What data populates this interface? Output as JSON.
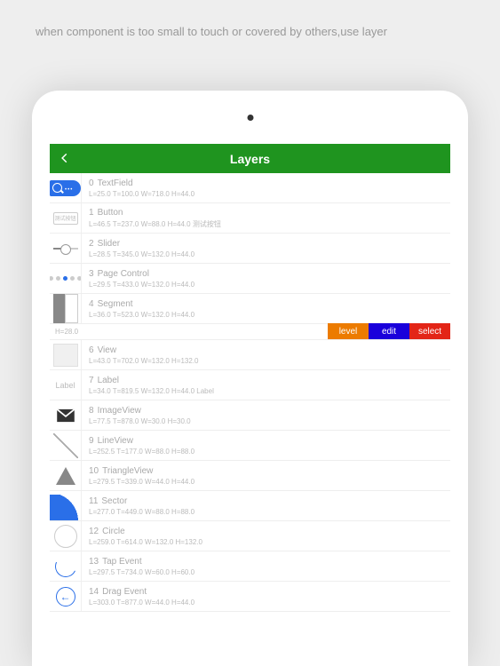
{
  "caption": "when component is too small to touch or covered by others,use layer",
  "navbar": {
    "title": "Layers"
  },
  "actions": {
    "level": "level",
    "edit": "edit",
    "select": "select"
  },
  "section": {
    "h": "H=28.0"
  },
  "buttonText": "测试按钮",
  "labelText": "Label",
  "rows": [
    {
      "idx": "0",
      "name": "TextField",
      "meta": "L=25.0 T=100.0 W=718.0 H=44.0"
    },
    {
      "idx": "1",
      "name": "Button",
      "meta": "L=46.5 T=237.0 W=88.0 H=44.0 测试按钮"
    },
    {
      "idx": "2",
      "name": "Slider",
      "meta": "L=28.5 T=345.0 W=132.0 H=44.0"
    },
    {
      "idx": "3",
      "name": "Page Control",
      "meta": "L=29.5 T=433.0 W=132.0 H=44.0"
    },
    {
      "idx": "4",
      "name": "Segment",
      "meta": "L=36.0 T=523.0 W=132.0 H=44.0"
    },
    {
      "idx": "6",
      "name": "View",
      "meta": "L=43.0 T=702.0 W=132.0 H=132.0"
    },
    {
      "idx": "7",
      "name": "Label",
      "meta": "L=34.0 T=819.5 W=132.0 H=44.0 Label"
    },
    {
      "idx": "8",
      "name": "ImageView",
      "meta": "L=77.5 T=878.0 W=30.0 H=30.0"
    },
    {
      "idx": "9",
      "name": "LineView",
      "meta": "L=252.5 T=177.0 W=88.0 H=88.0"
    },
    {
      "idx": "10",
      "name": "TriangleView",
      "meta": "L=279.5 T=339.0 W=44.0 H=44.0"
    },
    {
      "idx": "11",
      "name": "Sector",
      "meta": "L=277.0 T=449.0 W=88.0 H=88.0"
    },
    {
      "idx": "12",
      "name": "Circle",
      "meta": "L=259.0 T=614.0 W=132.0 H=132.0"
    },
    {
      "idx": "13",
      "name": "Tap Event",
      "meta": "L=297.5 T=734.0 W=60.0 H=60.0"
    },
    {
      "idx": "14",
      "name": "Drag Event",
      "meta": "L=303.0 T=877.0 W=44.0 H=44.0"
    }
  ]
}
